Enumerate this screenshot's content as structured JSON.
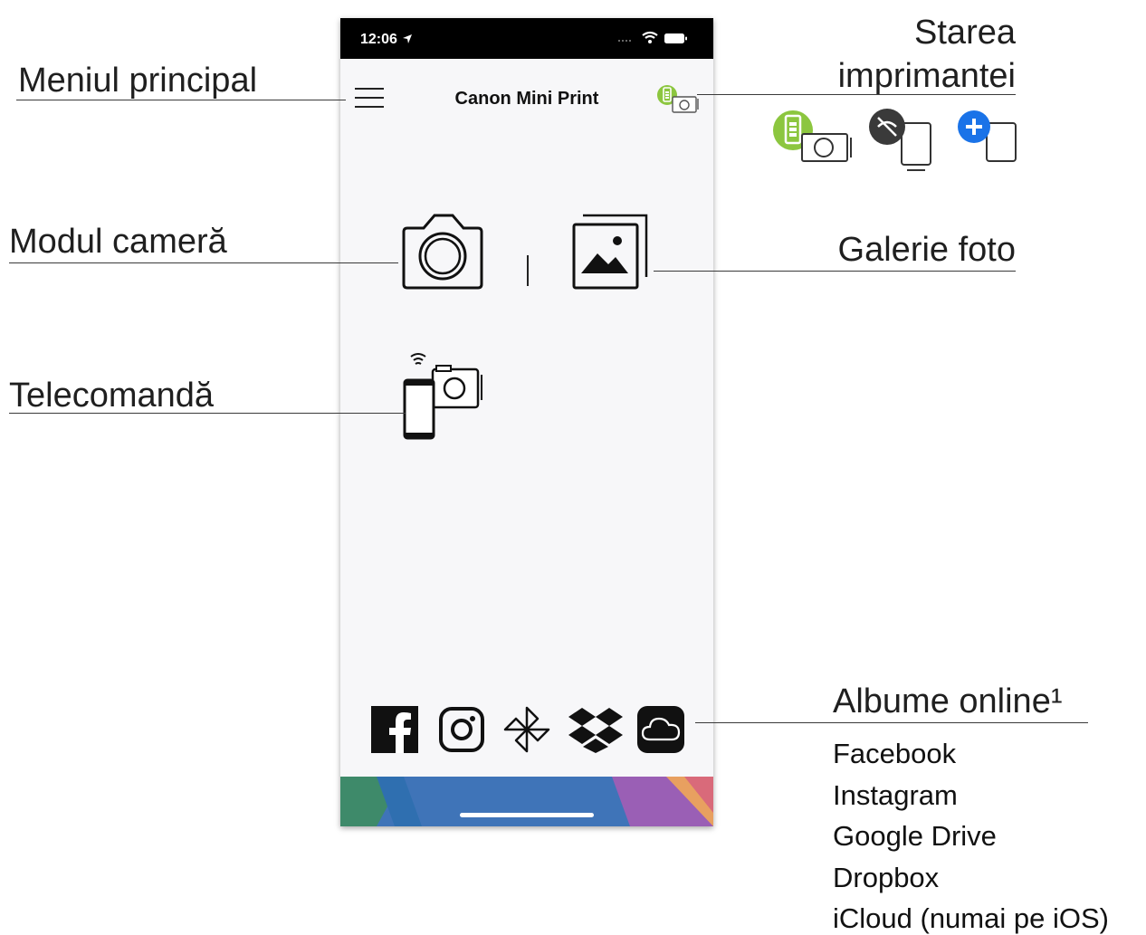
{
  "phone": {
    "status_time": "12:06",
    "app_title": "Canon Mini Print",
    "colors": {
      "battery_green": "#8cc63f",
      "plus_blue": "#1a73e8",
      "disconnected_gray": "#3a3a3a"
    }
  },
  "callouts": {
    "main_menu": "Meniul principal",
    "printer_status_line1": "Starea",
    "printer_status_line2": "imprimantei",
    "camera_mode": "Modul cameră",
    "photo_gallery": "Galerie foto",
    "remote": "Telecomandă",
    "online_albums": "Albume online¹"
  },
  "online_albums_list": [
    "Facebook",
    "Instagram",
    "Google Drive",
    "Dropbox",
    "iCloud (numai pe iOS)"
  ],
  "icons": {
    "menu": "hamburger-menu-icon",
    "printer_status": "printer-battery-status-icon",
    "camera": "camera-icon",
    "gallery": "photo-gallery-icon",
    "remote": "remote-control-icon",
    "facebook": "facebook-icon",
    "instagram": "instagram-icon",
    "google_drive": "google-drive-icon",
    "dropbox": "dropbox-icon",
    "icloud": "icloud-icon"
  }
}
